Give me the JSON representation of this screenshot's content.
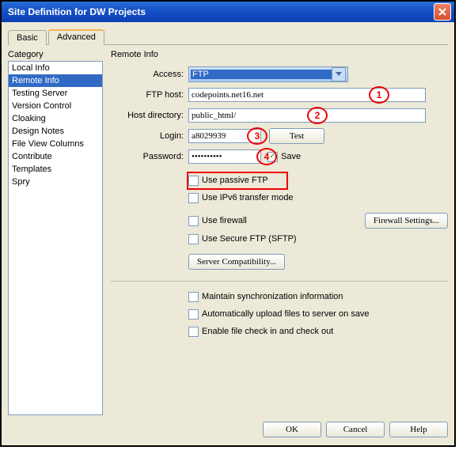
{
  "window": {
    "title": "Site Definition for DW Projects"
  },
  "tabs": {
    "basic": "Basic",
    "advanced": "Advanced"
  },
  "sidebar": {
    "label": "Category",
    "items": [
      "Local Info",
      "Remote Info",
      "Testing Server",
      "Version Control",
      "Cloaking",
      "Design Notes",
      "File View Columns",
      "Contribute",
      "Templates",
      "Spry"
    ],
    "selected_index": 1
  },
  "panel": {
    "title": "Remote Info",
    "access_label": "Access:",
    "access_value": "FTP",
    "ftphost_label": "FTP host:",
    "ftphost_value": "codepoints.net16.net",
    "hostdir_label": "Host directory:",
    "hostdir_value": "public_html/",
    "login_label": "Login:",
    "login_value": "a8029939",
    "test_button": "Test",
    "password_label": "Password:",
    "password_value": "••••••••••",
    "save_label": "Save",
    "save_checked": true,
    "passive_label": "Use passive FTP",
    "ipv6_label": "Use IPv6 transfer mode",
    "firewall_label": "Use firewall",
    "firewall_button": "Firewall Settings...",
    "sftp_label": "Use Secure FTP (SFTP)",
    "compat_button": "Server Compatibility...",
    "sync_label": "Maintain synchronization information",
    "autoupload_label": "Automatically upload files to server on save",
    "checkin_label": "Enable file check in and check out"
  },
  "footer": {
    "ok": "OK",
    "cancel": "Cancel",
    "help": "Help"
  },
  "callouts": {
    "c1": "1",
    "c2": "2",
    "c3": "3",
    "c4": "4"
  }
}
